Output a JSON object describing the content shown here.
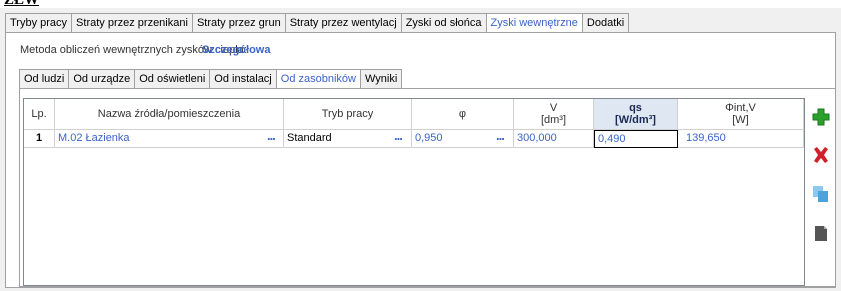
{
  "fragment": "ZŁW",
  "main_tabs": [
    {
      "label": "Tryby pracy"
    },
    {
      "label": "Straty przez przenikani"
    },
    {
      "label": "Straty przez grun"
    },
    {
      "label": "Straty przez wentylacj"
    },
    {
      "label": "Zyski od słońca"
    },
    {
      "label": "Zyski wewnętrzne"
    },
    {
      "label": "Dodatki"
    }
  ],
  "method": {
    "label": "Metoda obliczeń wewnętrznych zysków ciepła:",
    "value": "Szczegółowa"
  },
  "sub_tabs": [
    {
      "label": "Od ludzi"
    },
    {
      "label": "Od urządze"
    },
    {
      "label": "Od oświetleni"
    },
    {
      "label": "Od instalacj"
    },
    {
      "label": "Od zasobników"
    },
    {
      "label": "Wyniki"
    }
  ],
  "table": {
    "headers": {
      "lp": "Lp.",
      "name": "Nazwa źródła/pomieszczenia",
      "mode": "Tryb pracy",
      "phi": "φ",
      "v_top": "V",
      "v_unit": "[dm³]",
      "qs_top": "qs",
      "qs_unit": "[W/dm³]",
      "fi_top": "Φint,V",
      "fi_unit": "[W]"
    },
    "rows": [
      {
        "lp": "1",
        "name": "M.02 Łazienka",
        "mode": "Standard",
        "phi": "0,950",
        "v": "300,000",
        "qs": "0,490",
        "fi": "139,650"
      }
    ]
  },
  "dots": "...",
  "side_buttons": [
    {
      "icon": "add-icon",
      "color": "#2ca02c"
    },
    {
      "icon": "delete-icon",
      "color": "#d0202c"
    },
    {
      "icon": "copy-icon",
      "color": "#4aa3df"
    },
    {
      "icon": "paste-icon",
      "color": "#555555"
    }
  ]
}
